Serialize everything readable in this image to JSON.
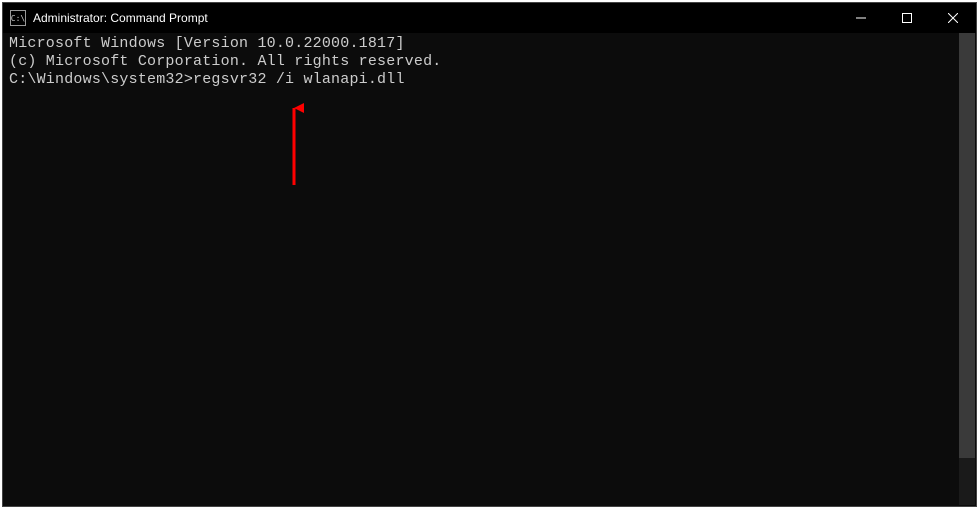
{
  "window": {
    "title": "Administrator: Command Prompt",
    "icon_text": "C:\\"
  },
  "terminal": {
    "line1": "Microsoft Windows [Version 10.0.22000.1817]",
    "line2": "(c) Microsoft Corporation. All rights reserved.",
    "blank": "",
    "prompt": "C:\\Windows\\system32>",
    "command": "regsvr32 /i wlanapi.dll"
  },
  "annotation": {
    "arrow_color": "#ff0000"
  }
}
